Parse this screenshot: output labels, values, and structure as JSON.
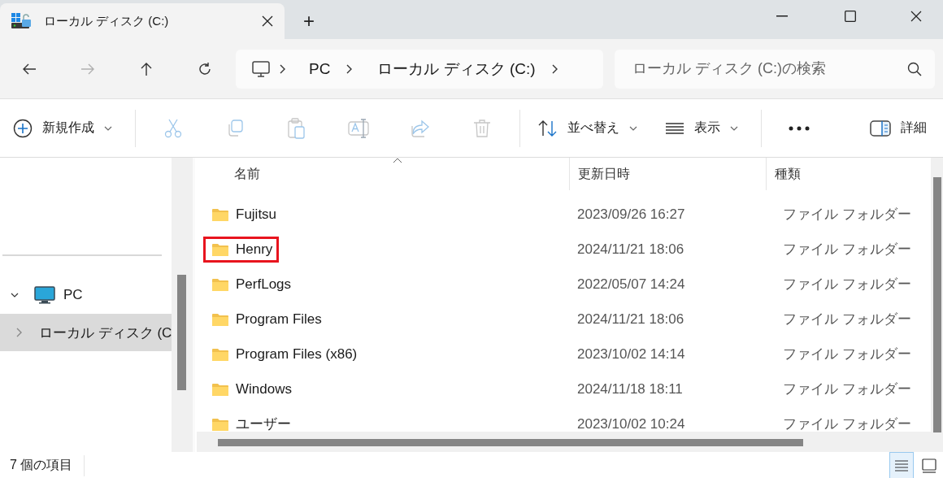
{
  "window": {
    "tab_title": "ローカル ディスク (C:)",
    "new_tab": "+"
  },
  "nav": {
    "buttons": [
      {
        "kind": "back",
        "disabled": false
      },
      {
        "kind": "forward",
        "disabled": true
      },
      {
        "kind": "up",
        "disabled": false
      },
      {
        "kind": "refresh",
        "disabled": false
      }
    ],
    "breadcrumbs": [
      "PC",
      "ローカル ディスク (C:)"
    ],
    "search": {
      "placeholder": "ローカル ディスク (C:)の検索"
    }
  },
  "toolbar": {
    "groups": [
      [
        {
          "kind": "new",
          "label": "新規作成"
        }
      ],
      [
        {
          "kind": "cut",
          "disabled": true
        },
        {
          "kind": "copy",
          "disabled": true
        },
        {
          "kind": "paste",
          "disabled": true
        },
        {
          "kind": "rename",
          "disabled": true
        },
        {
          "kind": "share",
          "disabled": true
        },
        {
          "kind": "delete",
          "disabled": true
        }
      ],
      [
        {
          "kind": "sort",
          "label": "並べ替え"
        },
        {
          "kind": "view",
          "label": "表示"
        }
      ],
      [
        {
          "kind": "more"
        }
      ]
    ],
    "details": {
      "label": "詳細"
    }
  },
  "sidebar": {
    "items": [
      {
        "label": "PC",
        "kind": "pc",
        "expanded": true,
        "selected": false,
        "children": [
          {
            "label": "ローカル ディスク (C",
            "kind": "drive",
            "expanded": false,
            "selected": true
          }
        ]
      }
    ]
  },
  "table": {
    "columns": [
      {
        "label": "名前",
        "sorted": true
      },
      {
        "label": "更新日時",
        "sorted": false
      },
      {
        "label": "種類",
        "sorted": false
      }
    ],
    "rows": [
      {
        "name": "Fujitsu",
        "modified": "2023/09/26 16:27",
        "type": "ファイル フォルダー",
        "highlighted": false
      },
      {
        "name": "Henry",
        "modified": "2024/11/21 18:06",
        "type": "ファイル フォルダー",
        "highlighted": true
      },
      {
        "name": "PerfLogs",
        "modified": "2022/05/07 14:24",
        "type": "ファイル フォルダー",
        "highlighted": false
      },
      {
        "name": "Program Files",
        "modified": "2024/11/21 18:06",
        "type": "ファイル フォルダー",
        "highlighted": false
      },
      {
        "name": "Program Files (x86)",
        "modified": "2023/10/02 14:14",
        "type": "ファイル フォルダー",
        "highlighted": false
      },
      {
        "name": "Windows",
        "modified": "2024/11/18 18:11",
        "type": "ファイル フォルダー",
        "highlighted": false
      },
      {
        "name": "ユーザー",
        "modified": "2023/10/02 10:24",
        "type": "ファイル フォルダー",
        "highlighted": false
      }
    ]
  },
  "status_bar": {
    "item_count": "7 個の項目",
    "views": [
      {
        "kind": "details",
        "selected": true
      },
      {
        "kind": "tiles",
        "selected": false
      }
    ]
  }
}
